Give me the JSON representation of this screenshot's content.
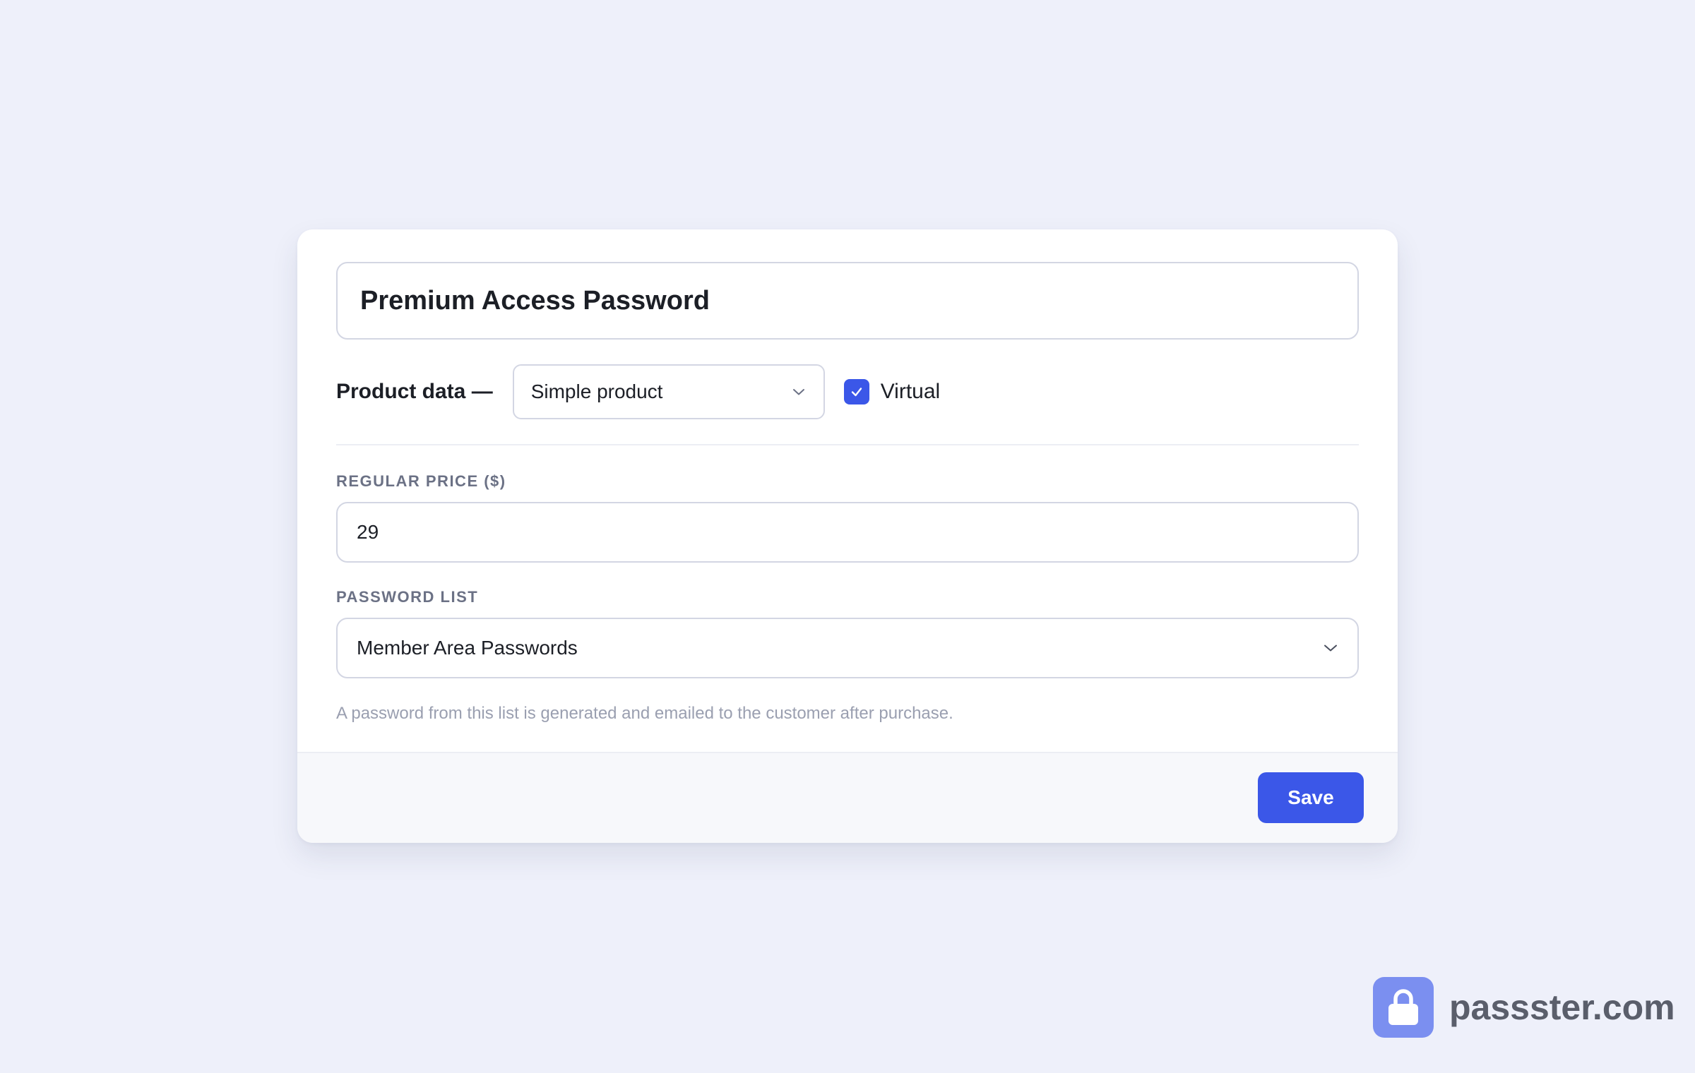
{
  "product": {
    "title_value": "Premium Access Password"
  },
  "product_data": {
    "label": "Product data —",
    "type_selected": "Simple product",
    "virtual_label": "Virtual",
    "virtual_checked": true
  },
  "pricing": {
    "label": "REGULAR PRICE ($)",
    "value": "29"
  },
  "password_list": {
    "label": "PASSWORD LIST",
    "selected": "Member Area Passwords",
    "helper": "A password from this list is generated and emailed to the customer after purchase."
  },
  "footer": {
    "save_label": "Save"
  },
  "brand": {
    "text": "passster.com",
    "icon": "lock-icon"
  },
  "colors": {
    "accent": "#3b57e8",
    "background": "#eef0fa",
    "brand_badge": "#7b8ff0"
  }
}
